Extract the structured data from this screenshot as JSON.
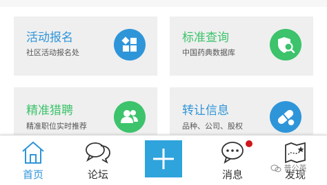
{
  "cards": [
    {
      "title": "活动报名",
      "subtitle": "社区活动报名处",
      "icon": "grid-icon",
      "color": "#2f95d9"
    },
    {
      "title": "标准查询",
      "subtitle": "中国药典数据库",
      "icon": "shield-search-icon",
      "color": "#3cc36b"
    },
    {
      "title": "精准猎聘",
      "subtitle": "精准职位实时推荐",
      "icon": "people-icon",
      "color": "#3cc36b"
    },
    {
      "title": "转让信息",
      "subtitle": "品种、公司、股权",
      "icon": "pill-icon",
      "color": "#2f95d9"
    }
  ],
  "tabs": [
    {
      "label": "首页",
      "icon": "home-icon",
      "active": true
    },
    {
      "label": "论坛",
      "icon": "chat-bubbles-icon",
      "active": false
    },
    {
      "label": "",
      "icon": "plus-icon",
      "active": false
    },
    {
      "label": "消息",
      "icon": "message-icon",
      "active": false,
      "badge": "unread-dot"
    },
    {
      "label": "发现",
      "icon": "map-star-icon",
      "active": false
    }
  ],
  "watermark": "普公英",
  "colors": {
    "active_tab": "#2f95d9",
    "title_blue": "#2f95d9",
    "title_green": "#3cc36b",
    "badge": "#d0161b"
  }
}
